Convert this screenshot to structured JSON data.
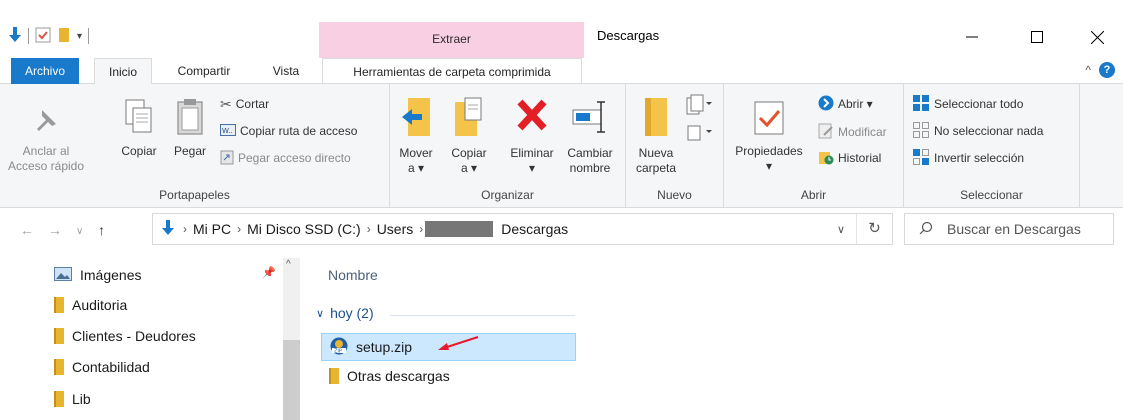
{
  "window": {
    "title": "Descargas",
    "context_tab_group": "Extraer"
  },
  "tabs": {
    "file": "Archivo",
    "home": "Inicio",
    "share": "Compartir",
    "view": "Vista",
    "context": "Herramientas de carpeta comprimida"
  },
  "ribbon": {
    "portapapeles": {
      "label": "Portapapeles",
      "pin_line1": "Anclar al",
      "pin_line2": "Acceso rápido",
      "copy": "Copiar",
      "paste": "Pegar",
      "cut": "Cortar",
      "copy_path": "Copiar ruta de acceso",
      "paste_shortcut": "Pegar acceso directo"
    },
    "organizar": {
      "label": "Organizar",
      "move_line1": "Mover",
      "move_line2": "a ▾",
      "copy_line1": "Copiar",
      "copy_line2": "a ▾",
      "delete": "Eliminar",
      "delete_arrow": "▾",
      "rename_line1": "Cambiar",
      "rename_line2": "nombre"
    },
    "nuevo": {
      "label": "Nuevo",
      "new_folder_line1": "Nueva",
      "new_folder_line2": "carpeta"
    },
    "abrir": {
      "label": "Abrir",
      "properties": "Propiedades",
      "properties_arrow": "▾",
      "open": "Abrir ▾",
      "edit": "Modificar",
      "history": "Historial"
    },
    "seleccionar": {
      "label": "Seleccionar",
      "select_all": "Seleccionar todo",
      "select_none": "No seleccionar nada",
      "invert": "Invertir selección"
    }
  },
  "address": {
    "crumbs": [
      "Mi PC",
      "Mi Disco SSD (C:)",
      "Users",
      "Descargas"
    ],
    "search_placeholder": "Buscar en Descargas"
  },
  "nav_pane": {
    "items": [
      "Imágenes",
      "Auditoria",
      "Clientes - Deudores",
      "Contabilidad",
      "Lib"
    ]
  },
  "content": {
    "column_name": "Nombre",
    "group": "hoy (2)",
    "files": [
      "setup.zip",
      "Otras descargas"
    ]
  },
  "colors": {
    "file_tab": "#1979ca",
    "context_tab": "#f9cfe3",
    "selection": "#cce8ff",
    "annotation_arrow": "#e8192c"
  }
}
